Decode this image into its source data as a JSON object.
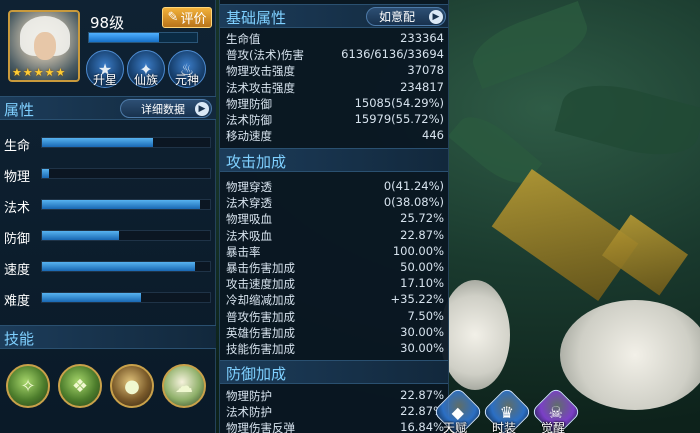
{
  "hero": {
    "level": "98级",
    "rate_label": "评价",
    "xp_fraction": 0.65,
    "star_count": 5,
    "buttons": [
      {
        "label": "升星",
        "icon": "star-upgrade-icon"
      },
      {
        "label": "仙族",
        "icon": "wing-icon"
      },
      {
        "label": "元神",
        "icon": "flame-icon"
      }
    ]
  },
  "attributes": {
    "title": "属性",
    "detail_button": "详细数据",
    "rows": [
      {
        "label": "生命",
        "fraction": 0.66
      },
      {
        "label": "物理",
        "fraction": 0.04
      },
      {
        "label": "法术",
        "fraction": 0.94
      },
      {
        "label": "防御",
        "fraction": 0.46
      },
      {
        "label": "速度",
        "fraction": 0.91
      },
      {
        "label": "难度",
        "fraction": 0.59
      }
    ]
  },
  "skills": {
    "title": "技能",
    "icons": [
      "skill-1-icon",
      "skill-2-icon",
      "skill-3-icon",
      "skill-4-icon"
    ]
  },
  "basic": {
    "title": "基础属性",
    "preset_button": "如意配",
    "stats": [
      {
        "k": "生命值",
        "v": "233364"
      },
      {
        "k": "普攻(法术)伤害",
        "v": "6136/6136/33694"
      },
      {
        "k": "物理攻击强度",
        "v": "37078"
      },
      {
        "k": "法术攻击强度",
        "v": "234817"
      },
      {
        "k": "物理防御",
        "v": "15085(54.29%)"
      },
      {
        "k": "法术防御",
        "v": "15979(55.72%)"
      },
      {
        "k": "移动速度",
        "v": "446"
      }
    ]
  },
  "attack": {
    "title": "攻击加成",
    "stats": [
      {
        "k": "物理穿透",
        "v": "0(41.24%)"
      },
      {
        "k": "法术穿透",
        "v": "0(38.08%)"
      },
      {
        "k": "物理吸血",
        "v": "25.72%"
      },
      {
        "k": "法术吸血",
        "v": "22.87%"
      },
      {
        "k": "暴击率",
        "v": "100.00%"
      },
      {
        "k": "暴击伤害加成",
        "v": "50.00%"
      },
      {
        "k": "攻击速度加成",
        "v": "17.10%"
      },
      {
        "k": "冷却缩减加成",
        "v": "+35.22%"
      },
      {
        "k": "普攻伤害加成",
        "v": "7.50%"
      },
      {
        "k": "英雄伤害加成",
        "v": "30.00%"
      },
      {
        "k": "技能伤害加成",
        "v": "30.00%"
      }
    ]
  },
  "defense": {
    "title": "防御加成",
    "stats": [
      {
        "k": "物理防护",
        "v": "22.87%"
      },
      {
        "k": "法术防护",
        "v": "22.87%"
      },
      {
        "k": "物理伤害反弹",
        "v": "16.84%"
      }
    ]
  },
  "bottom_buttons": [
    {
      "label": "天赋",
      "icon": "talent-icon",
      "color": "#2b6fc4"
    },
    {
      "label": "时装",
      "icon": "costume-icon",
      "color": "#2b6fc4"
    },
    {
      "label": "觉醒",
      "icon": "awaken-icon",
      "color": "#7b3fc7"
    }
  ]
}
